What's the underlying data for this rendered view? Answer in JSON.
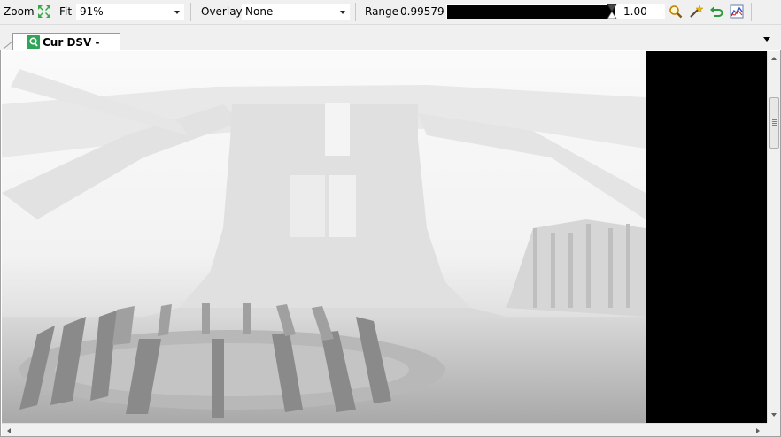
{
  "toolbar": {
    "zoom_label": "Zoom",
    "fit_label": "Fit",
    "zoom_value": "91%",
    "overlay_label": "Overlay",
    "overlay_value": "None",
    "range_label": "Range",
    "range_min": "0.99579",
    "range_max": "1.00",
    "icons": [
      "fit-to-window-icon",
      "magnifier-icon",
      "magic-wand-icon",
      "undo-icon",
      "histogram-icon"
    ]
  },
  "tabs": [
    {
      "label": "Cur DSV - DXUT",
      "active": true
    }
  ],
  "colors": {
    "tab_icon": "#2fa55a",
    "range_bar": "#000000",
    "background": "#f0f0f0"
  }
}
